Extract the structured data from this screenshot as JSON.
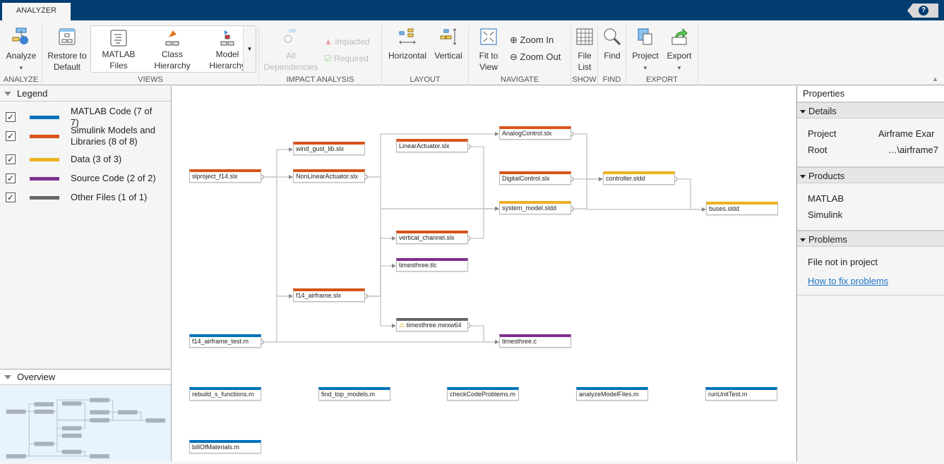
{
  "app": {
    "tab": "ANALYZER",
    "help": "?"
  },
  "ribbon": {
    "analyze": {
      "button": "Analyze",
      "group": "ANALYZE"
    },
    "views": {
      "restore": "Restore to Default",
      "matlab_files": "MATLAB Files",
      "class_hierarchy": "Class Hierarchy",
      "model_hierarchy": "Model Hierarchy",
      "group": "VIEWS"
    },
    "impact": {
      "all": "All Dependencies",
      "impacted": "Impacted",
      "required": "Required",
      "group": "IMPACT ANALYSIS"
    },
    "layout": {
      "horizontal": "Horizontal",
      "vertical": "Vertical",
      "group": "LAYOUT"
    },
    "navigate": {
      "fit": "Fit to View",
      "zoom_in": "Zoom In",
      "zoom_out": "Zoom Out",
      "group": "NAVIGATE"
    },
    "show": {
      "file_list": "File List",
      "group": "SHOW"
    },
    "find": {
      "find": "Find",
      "group": "FIND"
    },
    "export": {
      "project": "Project",
      "export": "Export",
      "group": "EXPORT"
    }
  },
  "legend": {
    "title": "Legend",
    "items": [
      {
        "label": "MATLAB Code (7 of 7)",
        "color": "#0072bd"
      },
      {
        "label": "Simulink Models and Libraries (8 of 8)",
        "color": "#d95319"
      },
      {
        "label": "Data (3 of 3)",
        "color": "#edb120"
      },
      {
        "label": "Source Code (2 of 2)",
        "color": "#7e2f8e"
      },
      {
        "label": "Other Files (1 of 1)",
        "color": "#666666"
      }
    ]
  },
  "overview": {
    "title": "Overview"
  },
  "graph": {
    "nodes": [
      {
        "id": "slp",
        "label": "slproject_f14.slx",
        "cat": 1
      },
      {
        "id": "wind",
        "label": "wind_gust_lib.slx",
        "cat": 1
      },
      {
        "id": "nla",
        "label": "NonLinearActuator.slx",
        "cat": 1
      },
      {
        "id": "la",
        "label": "LinearActuator.slx",
        "cat": 1
      },
      {
        "id": "ac",
        "label": "AnalogControl.slx",
        "cat": 1
      },
      {
        "id": "dc",
        "label": "DigitalControl.slx",
        "cat": 1
      },
      {
        "id": "sm",
        "label": "system_model.sldd",
        "cat": 2
      },
      {
        "id": "ctl",
        "label": "controller.sldd",
        "cat": 2
      },
      {
        "id": "bus",
        "label": "buses.sldd",
        "cat": 2
      },
      {
        "id": "vc",
        "label": "vertical_channel.slx",
        "cat": 1
      },
      {
        "id": "tlc",
        "label": "timesthree.tlc",
        "cat": 3
      },
      {
        "id": "f14",
        "label": "f14_airframe.slx",
        "cat": 1
      },
      {
        "id": "mex",
        "label": "timesthree.mexw64",
        "cat": 4,
        "warning": true
      },
      {
        "id": "f14t",
        "label": "f14_airframe_test.m",
        "cat": 0
      },
      {
        "id": "tc",
        "label": "timesthree.c",
        "cat": 3
      },
      {
        "id": "rb",
        "label": "rebuild_s_functions.m",
        "cat": 0
      },
      {
        "id": "ftm",
        "label": "find_top_models.m",
        "cat": 0
      },
      {
        "id": "ccp",
        "label": "checkCodeProblems.m",
        "cat": 0
      },
      {
        "id": "amf",
        "label": "analyzeModelFiles.m",
        "cat": 0
      },
      {
        "id": "rut",
        "label": "runUnitTest.m",
        "cat": 0
      },
      {
        "id": "bom",
        "label": "billOfMaterials.m",
        "cat": 0
      }
    ],
    "edges": [
      [
        "slp",
        "wind"
      ],
      [
        "slp",
        "nla"
      ],
      [
        "slp",
        "f14"
      ],
      [
        "f14t",
        "f14"
      ],
      [
        "f14t",
        "tc"
      ],
      [
        "nla",
        "ac"
      ],
      [
        "nla",
        "sm"
      ],
      [
        "la",
        "sm"
      ],
      [
        "f14",
        "vc"
      ],
      [
        "f14",
        "tlc"
      ],
      [
        "f14",
        "mex"
      ],
      [
        "f14",
        "sm"
      ],
      [
        "vc",
        "sm"
      ],
      [
        "mex",
        "tc"
      ],
      [
        "ac",
        "ctl"
      ],
      [
        "dc",
        "ctl"
      ],
      [
        "sm",
        "ctl"
      ],
      [
        "sm",
        "bus"
      ],
      [
        "ctl",
        "bus"
      ]
    ]
  },
  "properties": {
    "title": "Properties",
    "details": {
      "title": "Details",
      "project_key": "Project",
      "project_val": "Airframe Exar",
      "root_key": "Root",
      "root_val": "…\\airframe7"
    },
    "products": {
      "title": "Products",
      "items": [
        "MATLAB",
        "Simulink"
      ]
    },
    "problems": {
      "title": "Problems",
      "text": "File not in project",
      "link": "How to fix problems"
    }
  }
}
